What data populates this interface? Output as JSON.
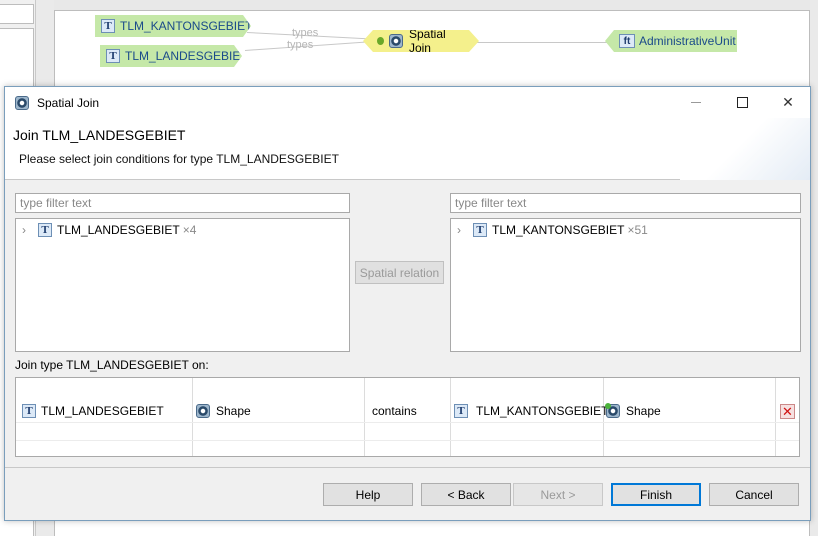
{
  "diagram": {
    "nodes": {
      "kantons": "TLM_KANTONSGEBIET",
      "landes": "TLM_LANDESGEBIET",
      "spatial_join": "Spatial Join",
      "admin_unit": "AdministrativeUnit"
    },
    "edge_labels": [
      "types",
      "types"
    ],
    "colors": {
      "type_node": "#c5e8a8",
      "join_node": "#f4f08c"
    }
  },
  "dialog": {
    "window_title": "Spatial Join",
    "header_title": "Join TLM_LANDESGEBIET",
    "header_desc": "Please select join conditions for type TLM_LANDESGEBIET",
    "left_filter_placeholder": "type filter text",
    "right_filter_placeholder": "type filter text",
    "left_tree": {
      "label": "TLM_LANDESGEBIET",
      "count": "×4"
    },
    "right_tree": {
      "label": "TLM_KANTONSGEBIET",
      "count": "×51"
    },
    "spatial_relation_button": "Spatial relation",
    "join_label": "Join type TLM_LANDESGEBIET on:",
    "join_row": {
      "left_type": "TLM_LANDESGEBIET",
      "left_property": "Shape",
      "relation": "contains",
      "right_type": "TLM_KANTONSGEBIET",
      "right_property": "Shape"
    },
    "buttons": {
      "help": "Help",
      "back": "< Back",
      "next": "Next >",
      "finish": "Finish",
      "cancel": "Cancel"
    }
  },
  "icons": {
    "type": "T",
    "feature_type": "ft",
    "delete": "✕"
  }
}
